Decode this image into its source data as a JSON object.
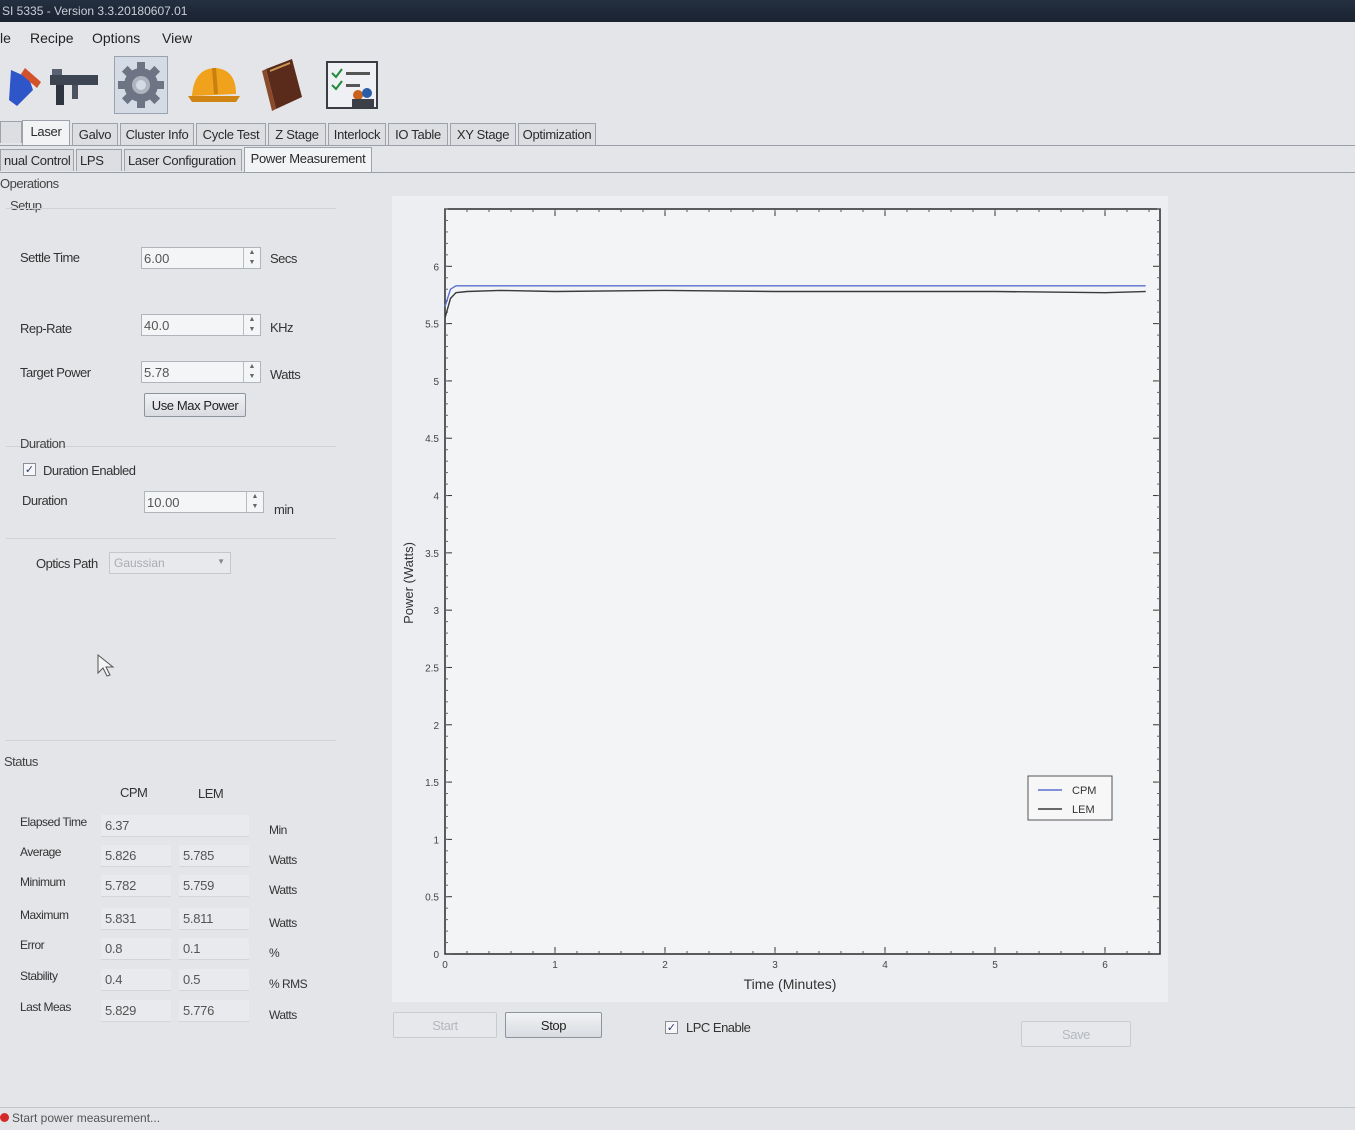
{
  "window": {
    "title": "SI 5335 - Version 3.3.20180607.01"
  },
  "menu": [
    "le",
    "Recipe",
    "Options",
    "View"
  ],
  "toolbar": [
    {
      "icon": "wrench-icon"
    },
    {
      "icon": "caliper-icon"
    },
    {
      "icon": "gear-icon"
    },
    {
      "icon": "hard-hat-icon"
    },
    {
      "icon": "book-icon"
    },
    {
      "icon": "checklist-users-icon"
    }
  ],
  "main_tabs": [
    "Laser",
    "Galvo",
    "Cluster Info",
    "Cycle Test",
    "Z Stage",
    "Interlock",
    "IO Table",
    "XY Stage",
    "Optimization"
  ],
  "sub_tabs": [
    "nual Control",
    "LPS",
    "Laser Configuration",
    "Power Measurement"
  ],
  "operations": {
    "title": "Operations",
    "setup": {
      "title": "Setup",
      "settle_time": {
        "label": "Settle Time",
        "value": "6.00",
        "unit": "Secs"
      },
      "rep_rate": {
        "label": "Rep-Rate",
        "value": "40.0",
        "unit": "KHz"
      },
      "target_power": {
        "label": "Target Power",
        "value": "5.78",
        "unit": "Watts"
      },
      "use_max_power": "Use Max Power"
    },
    "duration": {
      "title": "Duration",
      "enabled_label": "Duration Enabled",
      "enabled": true,
      "label": "Duration",
      "value": "10.00",
      "unit": "min"
    },
    "optics_path": {
      "label": "Optics Path",
      "value": "Gaussian"
    }
  },
  "status": {
    "title": "Status",
    "col_cpm": "CPM",
    "col_lem": "LEM",
    "rows": [
      {
        "label": "Elapsed Time",
        "cpm": "6.37",
        "lem": "",
        "unit": "Min"
      },
      {
        "label": "Average",
        "cpm": "5.826",
        "lem": "5.785",
        "unit": "Watts"
      },
      {
        "label": "Minimum",
        "cpm": "5.782",
        "lem": "5.759",
        "unit": "Watts"
      },
      {
        "label": "Maximum",
        "cpm": "5.831",
        "lem": "5.811",
        "unit": "Watts"
      },
      {
        "label": "Error",
        "cpm": "0.8",
        "lem": "0.1",
        "unit": "%"
      },
      {
        "label": "Stability",
        "cpm": "0.4",
        "lem": "0.5",
        "unit": "% RMS"
      },
      {
        "label": "Last Meas",
        "cpm": "5.829",
        "lem": "5.776",
        "unit": "Watts"
      }
    ]
  },
  "controls": {
    "start": "Start",
    "stop": "Stop",
    "lpc_enable_label": "LPC Enable",
    "lpc_enabled": true,
    "save": "Save"
  },
  "status_bar": {
    "message": "Start power measurement..."
  },
  "chart_data": {
    "type": "line",
    "xlabel": "Time (Minutes)",
    "ylabel": "Power (Watts)",
    "xlim": [
      0,
      6.5
    ],
    "ylim": [
      0,
      6.5
    ],
    "xticks": [
      "0",
      "1",
      "2",
      "3",
      "4",
      "5",
      "6"
    ],
    "yticks": [
      "0",
      "0.5",
      "1",
      "1.5",
      "2",
      "2.5",
      "3",
      "3.5",
      "4",
      "4.5",
      "5",
      "5.5",
      "6"
    ],
    "legend_position": "bottom-right",
    "series": [
      {
        "name": "CPM",
        "color": "#5a6fd0",
        "x": [
          0,
          0.05,
          0.1,
          0.2,
          0.5,
          1,
          2,
          3,
          4,
          5,
          6,
          6.37
        ],
        "y": [
          5.65,
          5.8,
          5.83,
          5.83,
          5.83,
          5.83,
          5.83,
          5.83,
          5.83,
          5.83,
          5.83,
          5.83
        ]
      },
      {
        "name": "LEM",
        "color": "#3a3a3a",
        "x": [
          0,
          0.05,
          0.1,
          0.2,
          0.5,
          1,
          2,
          3,
          4,
          5,
          6,
          6.37
        ],
        "y": [
          5.55,
          5.72,
          5.77,
          5.78,
          5.79,
          5.78,
          5.79,
          5.78,
          5.78,
          5.78,
          5.77,
          5.78
        ]
      }
    ]
  }
}
